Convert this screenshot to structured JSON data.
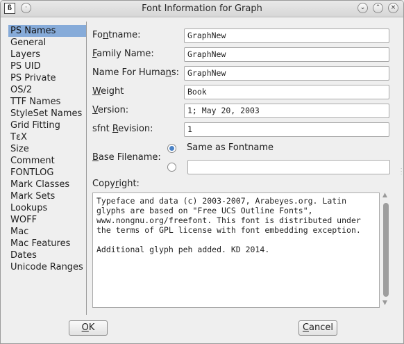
{
  "window": {
    "title": "Font Information for Graph"
  },
  "sidebar": {
    "items": [
      {
        "label": "PS Names",
        "selected": true
      },
      {
        "label": "General"
      },
      {
        "label": "Layers"
      },
      {
        "label": "PS UID"
      },
      {
        "label": "PS Private"
      },
      {
        "label": "OS/2"
      },
      {
        "label": "TTF Names"
      },
      {
        "label": "StyleSet Names"
      },
      {
        "label": "Grid Fitting"
      },
      {
        "label": "TεX"
      },
      {
        "label": "Size"
      },
      {
        "label": "Comment"
      },
      {
        "label": "FONTLOG"
      },
      {
        "label": "Mark Classes"
      },
      {
        "label": "Mark Sets"
      },
      {
        "label": "Lookups"
      },
      {
        "label": "WOFF"
      },
      {
        "label": "Mac"
      },
      {
        "label": "Mac Features"
      },
      {
        "label": "Dates"
      },
      {
        "label": "Unicode Ranges"
      }
    ]
  },
  "form": {
    "fontname": {
      "pre": "Fo",
      "u": "n",
      "post": "tname:",
      "value": "GraphNew"
    },
    "family": {
      "pre": "",
      "u": "F",
      "post": "amily Name:",
      "value": "GraphNew"
    },
    "humans": {
      "pre": "Name For Huma",
      "u": "n",
      "post": "s:",
      "value": "GraphNew"
    },
    "weight": {
      "pre": "",
      "u": "W",
      "post": "eight",
      "value": "Book"
    },
    "version": {
      "pre": "",
      "u": "V",
      "post": "ersion:",
      "value": "1; May 20, 2003"
    },
    "revision": {
      "pre": "sfnt ",
      "u": "R",
      "post": "evision:",
      "value": "1"
    },
    "base": {
      "pre": "",
      "u": "B",
      "post": "ase Filename:",
      "option_same": "Same as Fontname",
      "custom_value": ""
    },
    "copyright": {
      "pre": "Copy",
      "u": "r",
      "post": "ight:",
      "lines": [
        "Typeface and data (c) 2003-2007, Arabeyes.org. Latin",
        "glyphs are based on \"Free UCS Outline Fonts\",",
        "www.nongnu.org/freefont. This font is distributed under",
        "the terms of GPL license with font embedding exception.",
        "",
        "Additional glyph peh added. KD 2014."
      ]
    }
  },
  "buttons": {
    "ok": {
      "u": "O",
      "post": "K"
    },
    "cancel": {
      "u": "C",
      "post": "ancel"
    }
  }
}
